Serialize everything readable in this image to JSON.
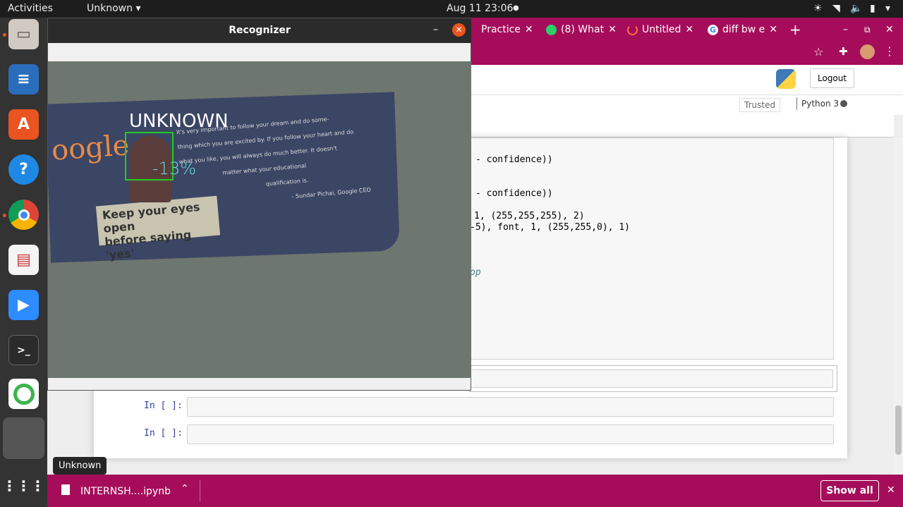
{
  "topbar": {
    "activities": "Activities",
    "app_menu": "Unknown",
    "clock": "Aug 11  23:06"
  },
  "recognizer": {
    "title": "Recognizer",
    "label": "UNKNOWN",
    "confidence": "13%",
    "poster_quote_lines": [
      "It's very important to follow your dream and do some-",
      "thing which you are excited by. If you follow your heart and do",
      "what you like, you will always do much better. It doesn't",
      "matter what your educational",
      "qualification is."
    ],
    "poster_author": "- Sundar Pichai, Google CEO",
    "poster_caption_1": "Keep your eyes open",
    "poster_caption_2": "before saying 'yes'"
  },
  "chrome": {
    "tabs": [
      {
        "label": "Practice",
        "icon": "page-icon"
      },
      {
        "label": "(8) What",
        "icon": "whatsapp-icon"
      },
      {
        "label": "Untitled",
        "icon": "loading-icon"
      },
      {
        "label": "diff bw e",
        "icon": "google-icon"
      }
    ]
  },
  "jupyter": {
    "logout_label": "Logout",
    "trusted_label": "Trusted",
    "kernel_label": "Python 3",
    "code_lines": [
      "- confidence))",
      "- confidence))",
      "1, (255,255,255), 2)",
      "-5), font, 1, (255,255,0), 1)",
      "op"
    ],
    "prompts": [
      "In [ ]:",
      "In [ ]:"
    ]
  },
  "downloads": {
    "file_name": "INTERNSH....ipynb",
    "show_all_label": "Show all"
  },
  "tooltip": "Unknown",
  "colors": {
    "chrome_accent": "#a50d5a",
    "face_box": "#22cc22",
    "confidence_text": "#66dddd"
  }
}
